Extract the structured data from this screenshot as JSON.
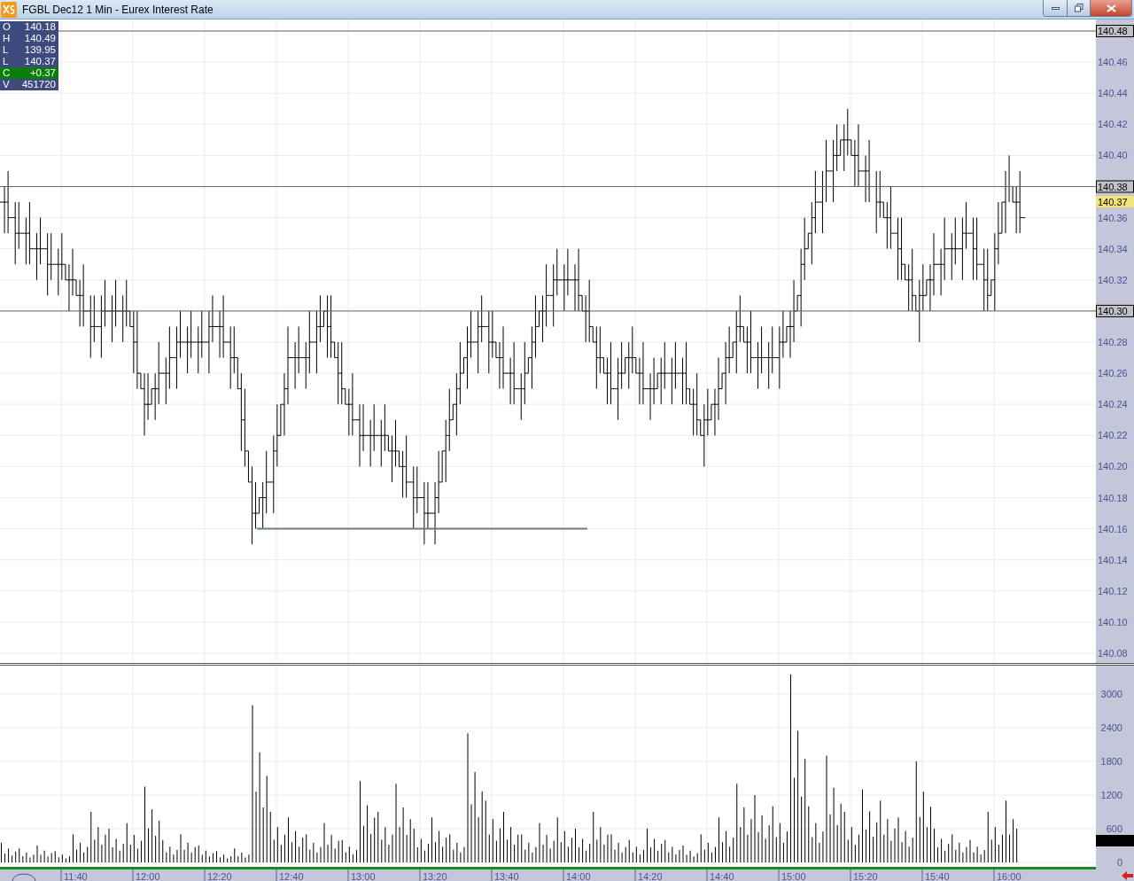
{
  "window": {
    "title": "FGBL Dec12 1 Min - Eurex Interest Rate"
  },
  "legend": [
    {
      "label": "O",
      "value": "140.18",
      "color": "#3d4a7e"
    },
    {
      "label": "H",
      "value": "140.49",
      "color": "#3d4a7e"
    },
    {
      "label": "L",
      "value": "139.95",
      "color": "#3d4a7e"
    },
    {
      "label": "L",
      "value": "140.37",
      "color": "#3d4a7e"
    },
    {
      "label": "C",
      "value": "+0.37",
      "color": "#0b7d0b"
    },
    {
      "label": "V",
      "value": "451720",
      "color": "#3d4a7e"
    }
  ],
  "price_axis": {
    "labels": [
      {
        "text": "140.48",
        "kind": "line"
      },
      {
        "text": "140.46",
        "kind": "tick"
      },
      {
        "text": "140.44",
        "kind": "tick"
      },
      {
        "text": "140.42",
        "kind": "tick"
      },
      {
        "text": "140.40",
        "kind": "tick"
      },
      {
        "text": "140.38",
        "kind": "line"
      },
      {
        "text": "140.37",
        "kind": "last"
      },
      {
        "text": "140.36",
        "kind": "tick"
      },
      {
        "text": "140.34",
        "kind": "tick"
      },
      {
        "text": "140.32",
        "kind": "tick"
      },
      {
        "text": "140.30",
        "kind": "line"
      },
      {
        "text": "140.28",
        "kind": "tick"
      },
      {
        "text": "140.26",
        "kind": "tick"
      },
      {
        "text": "140.24",
        "kind": "tick"
      },
      {
        "text": "140.22",
        "kind": "tick"
      },
      {
        "text": "140.20",
        "kind": "tick"
      },
      {
        "text": "140.18",
        "kind": "tick"
      },
      {
        "text": "140.16",
        "kind": "tick"
      },
      {
        "text": "140.14",
        "kind": "tick"
      },
      {
        "text": "140.12",
        "kind": "tick"
      },
      {
        "text": "140.10",
        "kind": "tick"
      },
      {
        "text": "140.08",
        "kind": "tick"
      }
    ]
  },
  "volume_axis": {
    "labels": [
      "3000",
      "2400",
      "1800",
      "1200",
      "600",
      "0"
    ]
  },
  "time_axis": {
    "labels": [
      "11:40",
      "12:00",
      "12:20",
      "12:40",
      "13:00",
      "13:20",
      "13:40",
      "14:00",
      "14:20",
      "14:40",
      "15:00",
      "15:20",
      "15:40",
      "16:00"
    ]
  }
}
